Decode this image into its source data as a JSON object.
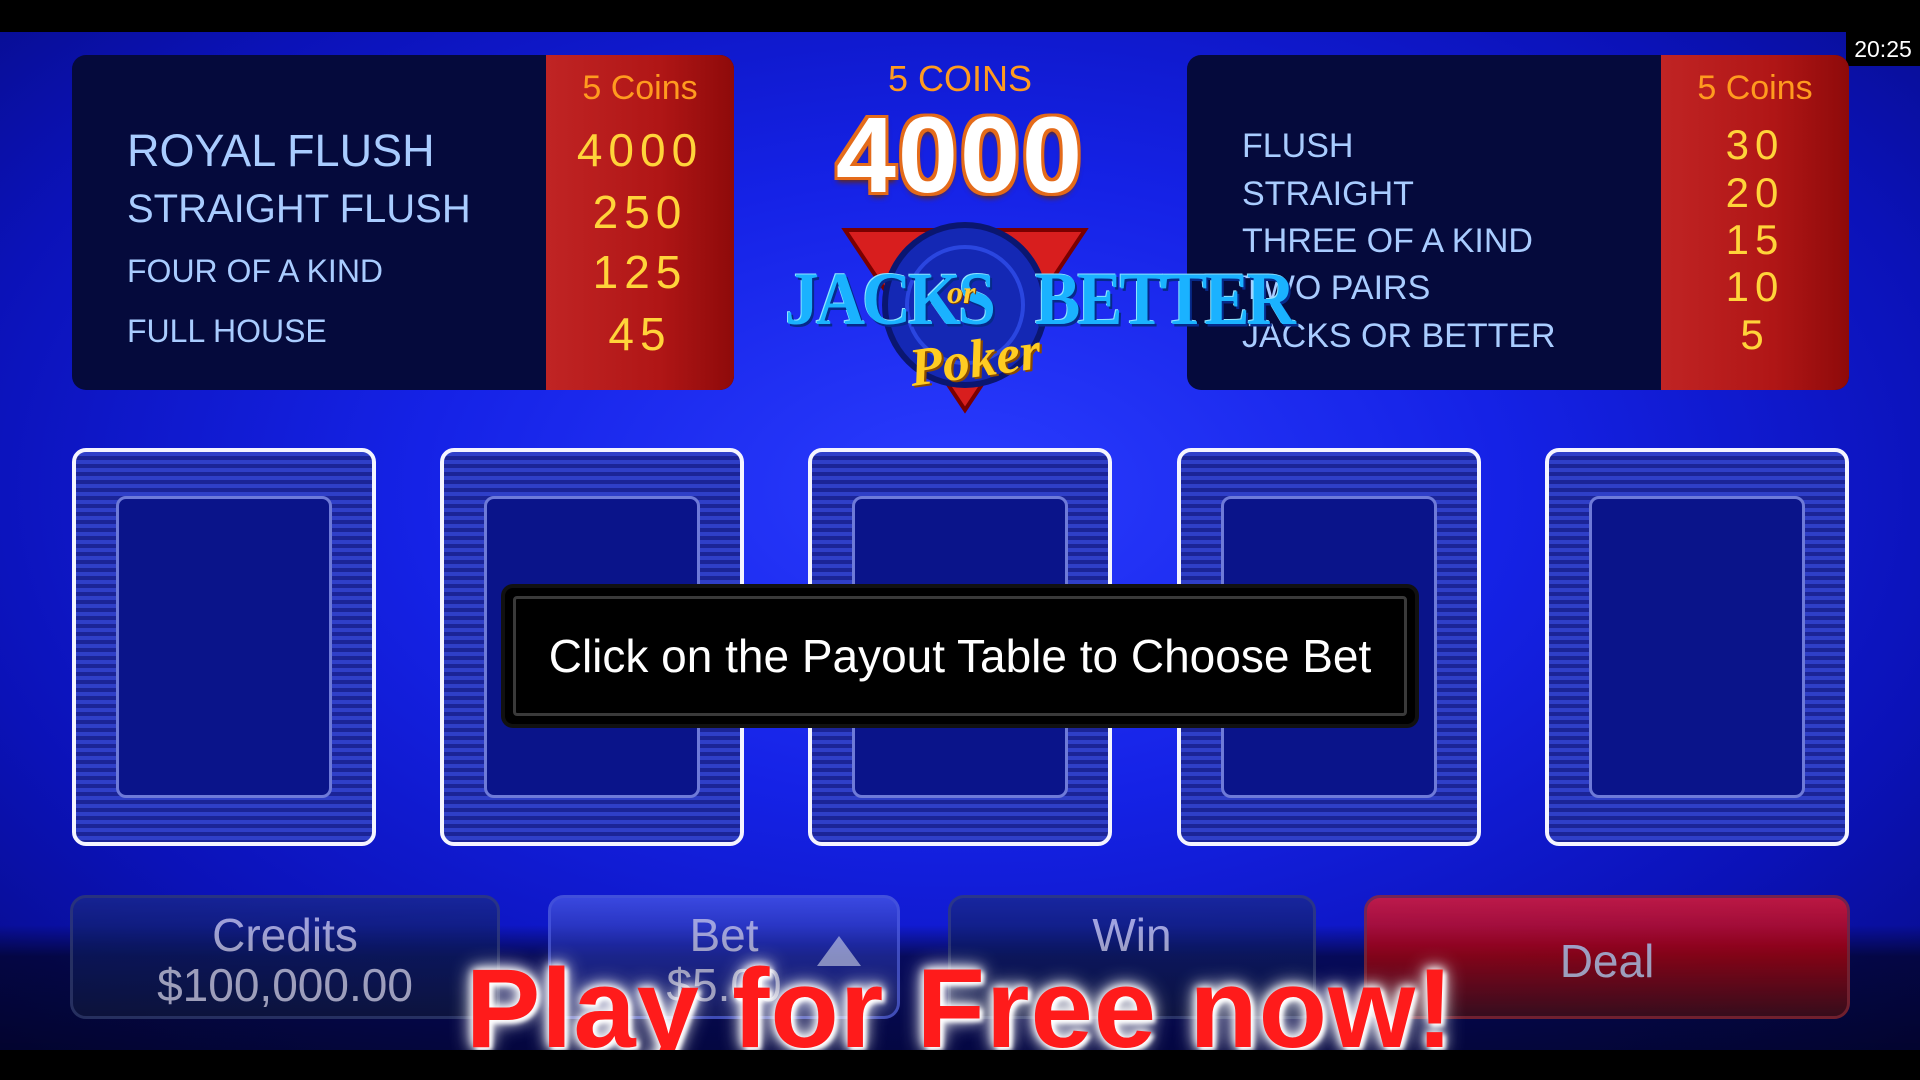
{
  "clock": "20:25",
  "paytable_left": {
    "header": "5 Coins",
    "rows": [
      {
        "hand": "ROYAL FLUSH",
        "payout": "4000"
      },
      {
        "hand": "STRAIGHT FLUSH",
        "payout": "250"
      },
      {
        "hand": "FOUR OF A KIND",
        "payout": "125"
      },
      {
        "hand": "FULL HOUSE",
        "payout": "45"
      }
    ]
  },
  "paytable_right": {
    "header": "5 Coins",
    "rows": [
      {
        "hand": "FLUSH",
        "payout": "30"
      },
      {
        "hand": "STRAIGHT",
        "payout": "20"
      },
      {
        "hand": "THREE OF A KIND",
        "payout": "15"
      },
      {
        "hand": "TWO PAIRS",
        "payout": "10"
      },
      {
        "hand": "JACKS OR BETTER",
        "payout": "5"
      }
    ]
  },
  "jackpot": {
    "label": "5 COINS",
    "value": "4000"
  },
  "logo": {
    "word1": "JACKS",
    "word_or": "or",
    "word2": "BETTER",
    "word3": "Poker"
  },
  "cards": [
    {
      "face": "back"
    },
    {
      "face": "back"
    },
    {
      "face": "back"
    },
    {
      "face": "back"
    },
    {
      "face": "back"
    }
  ],
  "message": "Click on the Payout Table to Choose Bet",
  "controls": {
    "credits_label": "Credits",
    "credits_value": "$100,000.00",
    "bet_label": "Bet",
    "bet_value": "$5.00",
    "win_label": "Win",
    "deal_label": "Deal"
  },
  "promo": "Play for Free now!",
  "colors": {
    "payout_highlight": "#c02424",
    "coins_header": "#ff9b1f",
    "payout_value": "#ffd43a",
    "hand_text": "#a9ccff",
    "promo_text": "#ff1b1b"
  }
}
